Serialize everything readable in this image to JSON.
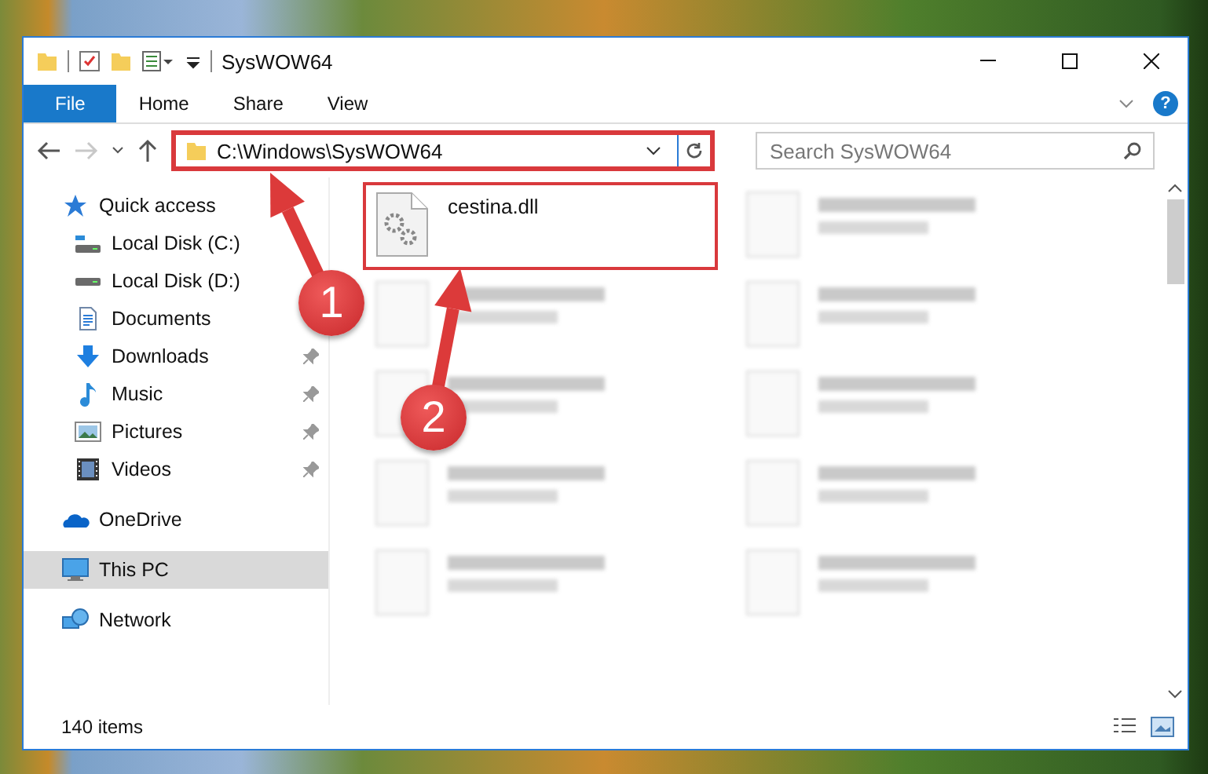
{
  "window": {
    "title": "SysWOW64"
  },
  "ribbon": {
    "tabs": [
      {
        "label": "File",
        "selected": true
      },
      {
        "label": "Home",
        "selected": false
      },
      {
        "label": "Share",
        "selected": false
      },
      {
        "label": "View",
        "selected": false
      }
    ],
    "help": "?"
  },
  "address": {
    "path": "C:\\Windows\\SysWOW64",
    "highlighted": true
  },
  "search": {
    "placeholder": "Search SysWOW64"
  },
  "sidebar": {
    "items": [
      {
        "label": "Quick access",
        "kind": "star",
        "selected": false,
        "pinned": false,
        "children": [
          {
            "label": "Local Disk (C:)",
            "kind": "system",
            "selected": false,
            "pinned": false
          },
          {
            "label": "Local Disk (D:)",
            "kind": "drive",
            "selected": false,
            "pinned": false
          },
          {
            "label": "Documents",
            "kind": "documents",
            "selected": false,
            "pinned": false
          },
          {
            "label": "Downloads",
            "kind": "downloads",
            "selected": false,
            "pinned": true
          },
          {
            "label": "Music",
            "kind": "music",
            "selected": false,
            "pinned": true
          },
          {
            "label": "Pictures",
            "kind": "pictures",
            "selected": false,
            "pinned": true
          },
          {
            "label": "Videos",
            "kind": "videos",
            "selected": false,
            "pinned": true
          }
        ]
      },
      {
        "label": "OneDrive",
        "kind": "cloud",
        "selected": false,
        "pinned": false
      },
      {
        "label": "This PC",
        "kind": "computer",
        "selected": true,
        "pinned": false
      },
      {
        "label": "Network",
        "kind": "network",
        "selected": false,
        "pinned": false
      }
    ]
  },
  "files": [
    {
      "name": "cestina.dll",
      "highlighted": true
    }
  ],
  "status_bar": {
    "item_count": "140 items"
  },
  "callouts": [
    {
      "label": "1"
    },
    {
      "label": "2"
    }
  ]
}
